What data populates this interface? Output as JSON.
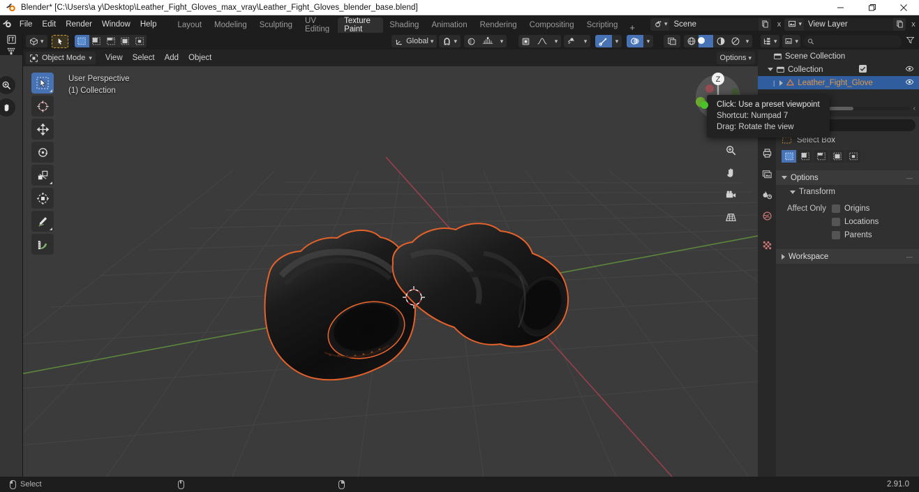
{
  "window": {
    "title": "Blender* [C:\\Users\\a y\\Desktop\\Leather_Fight_Gloves_max_vray\\Leather_Fight_Gloves_blender_base.blend]",
    "minimize": "minimize-icon",
    "maximize": "maximize-icon",
    "close": "close-icon"
  },
  "topbar": {
    "menus": [
      "File",
      "Edit",
      "Render",
      "Window",
      "Help"
    ],
    "workspaces": [
      {
        "label": "Layout",
        "active": false
      },
      {
        "label": "Modeling",
        "active": false
      },
      {
        "label": "Sculpting",
        "active": false
      },
      {
        "label": "UV Editing",
        "active": false
      },
      {
        "label": "Texture Paint",
        "active": true
      },
      {
        "label": "Shading",
        "active": false
      },
      {
        "label": "Animation",
        "active": false
      },
      {
        "label": "Rendering",
        "active": false
      },
      {
        "label": "Compositing",
        "active": false
      },
      {
        "label": "Scripting",
        "active": false
      }
    ],
    "add_workspace": "+",
    "scene": {
      "name": "Scene",
      "new_label": "new-scene-icon",
      "unlink_label": "x"
    },
    "view_layer": {
      "name": "View Layer",
      "new_label": "new-viewlayer-icon",
      "unlink_label": "x"
    }
  },
  "viewport_header": {
    "editor_type": "3d-viewport-icon",
    "mode": "Object Mode",
    "menus": [
      "View",
      "Select",
      "Add",
      "Object"
    ],
    "transform_orientation": "Global",
    "snap_label": "snap-magnet-icon",
    "proportional_label": "proportional-editing-icon",
    "options": "Options",
    "select_modes": [
      "select-box-new",
      "select-box-extend",
      "select-box-subtract",
      "select-box-invert",
      "select-box-intersect"
    ]
  },
  "viewport": {
    "perspective": "User Perspective",
    "collection_line": "(1) Collection",
    "gizmo_axis_label": "Z",
    "tools": [
      {
        "name": "tweak-select-tool",
        "active": true
      },
      {
        "name": "cursor-tool",
        "active": false
      },
      {
        "name": "move-tool",
        "active": false
      },
      {
        "name": "rotate-tool",
        "active": false
      },
      {
        "name": "scale-tool",
        "active": false
      },
      {
        "name": "transform-tool",
        "active": false
      },
      {
        "name": "annotate-tool",
        "active": false
      },
      {
        "name": "measure-tool",
        "active": false
      }
    ],
    "nav_icons": [
      "zoom-icon",
      "hand-move-icon",
      "camera-view-icon",
      "perspective-toggle-icon"
    ]
  },
  "tooltip": {
    "lines": [
      "Click: Use a preset viewpoint",
      "Shortcut: Numpad 7",
      "Drag: Rotate the view"
    ]
  },
  "outliner": {
    "display_mode_icon": "outliner-filter-icon",
    "display_type_icon": "outliner-display-icon",
    "search_placeholder": "",
    "filter_icon": "funnel-icon",
    "rows": [
      {
        "label": "Scene Collection",
        "icon": "collection-icon",
        "indent": 0,
        "selected": false,
        "checkbox": false,
        "eye": false,
        "expand": ""
      },
      {
        "label": "Collection",
        "icon": "collection-icon",
        "indent": 1,
        "selected": false,
        "checkbox": true,
        "eye": true,
        "expand": "down"
      },
      {
        "label": "Leather_Fight_Glove",
        "icon": "mesh-data-icon",
        "indent": 2,
        "selected": true,
        "checkbox": false,
        "eye": true,
        "expand": "right"
      }
    ]
  },
  "properties": {
    "tabs": [
      {
        "name": "tool-tab",
        "active": true
      },
      {
        "name": "render-tab",
        "active": false
      },
      {
        "name": "output-tab",
        "active": false
      },
      {
        "name": "view-layer-tab",
        "active": false
      },
      {
        "name": "scene-tab",
        "active": false
      },
      {
        "name": "world-tab",
        "active": false
      },
      {
        "name": "texture-tab",
        "active": false
      }
    ],
    "search_placeholder": "",
    "active_tool_label": "Select Box",
    "panels": [
      {
        "title": "Options",
        "expanded": true
      },
      {
        "title": "Transform",
        "expanded": true,
        "sub": true
      },
      {
        "title": "Workspace",
        "expanded": false
      }
    ],
    "affect_only_label": "Affect Only",
    "affect_only_options": [
      "Origins",
      "Locations",
      "Parents"
    ]
  },
  "statusbar": {
    "items": [
      {
        "icon": "mouse-left-icon",
        "label": "Select"
      },
      {
        "icon": "mouse-middle-icon",
        "label": ""
      },
      {
        "icon": "mouse-right-icon",
        "label": ""
      }
    ],
    "version": "2.91.0"
  },
  "colors": {
    "accent_blue": "#4772b3",
    "selection_orange": "#e5622a",
    "active_object_text": "#e09a4c",
    "viewport_bg": "#3b3b3b",
    "panel_bg": "#303030",
    "header_bg": "#1d1d1d",
    "tooltip_bg": "#222222",
    "green_dot": "#4ac32a"
  }
}
